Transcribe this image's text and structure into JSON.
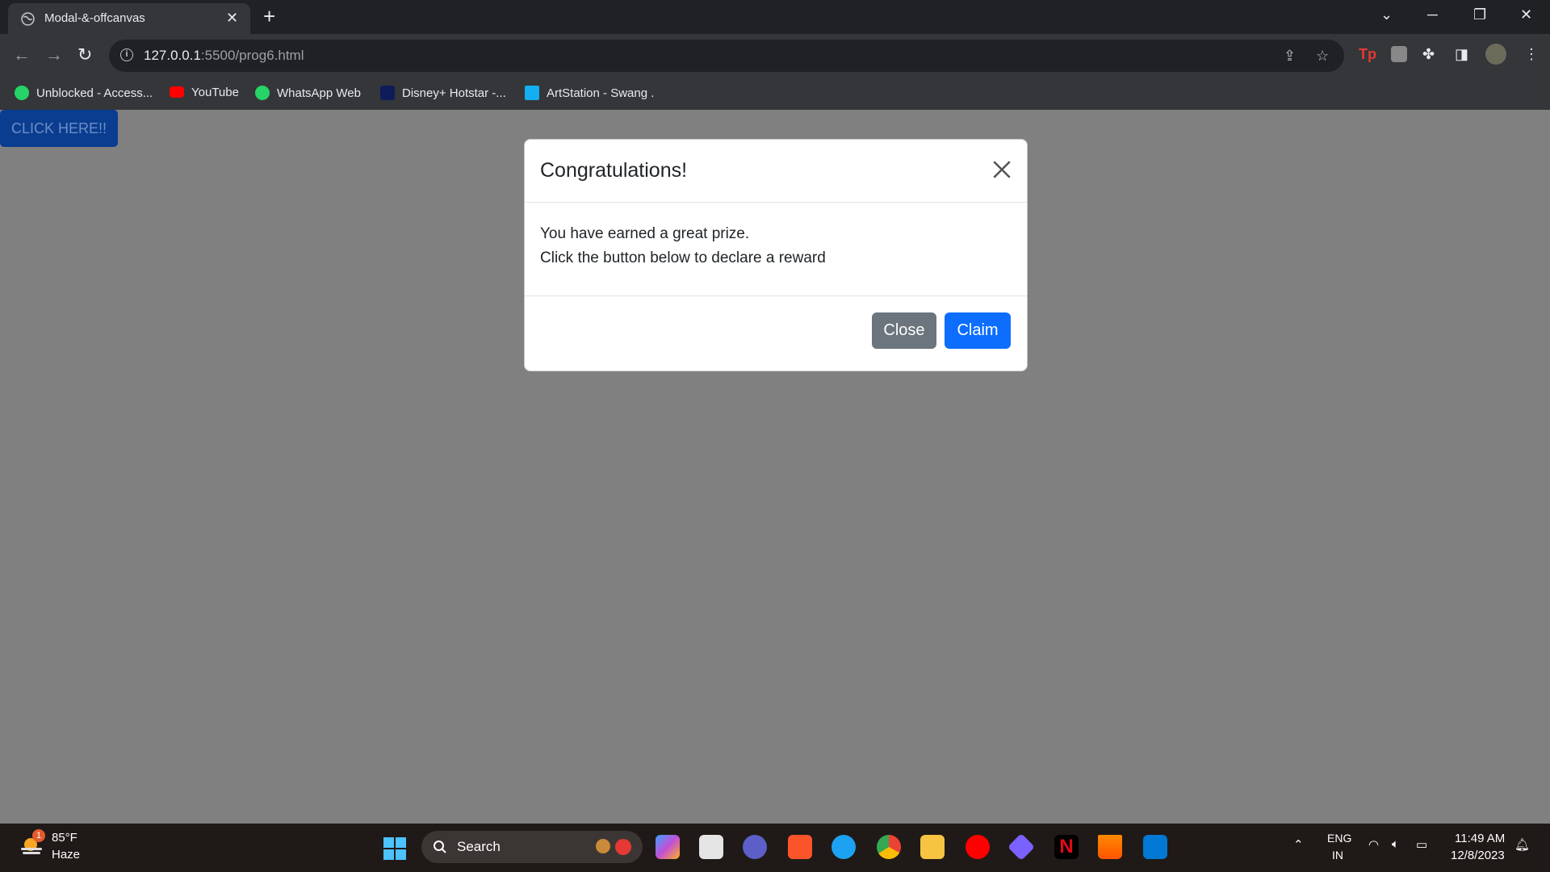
{
  "browser": {
    "tab_title": "Modal-&-offcanvas",
    "url_host": "127.0.0.1",
    "url_path": ":5500/prog6.html"
  },
  "bookmarks": [
    {
      "label": "Unblocked - Access...",
      "icon": "unblocked-icon",
      "color": "#25d366"
    },
    {
      "label": "YouTube",
      "icon": "youtube-icon",
      "color": "#ff0000"
    },
    {
      "label": "WhatsApp Web",
      "icon": "whatsapp-icon",
      "color": "#25d366"
    },
    {
      "label": "Disney+ Hotstar -...",
      "icon": "hotstar-icon",
      "color": "#0f1c5a"
    },
    {
      "label": "ArtStation - Swang .",
      "icon": "artstation-icon",
      "color": "#13aff0"
    }
  ],
  "page": {
    "trigger_label": "CLICK HERE!!"
  },
  "modal": {
    "title": "Congratulations!",
    "body_line1": "You have earned a great prize.",
    "body_line2": "Click the button below to declare a reward",
    "close_label": "Close",
    "claim_label": "Claim"
  },
  "taskbar": {
    "weather_temp": "85°F",
    "weather_desc": "Haze",
    "weather_badge": "1",
    "search_placeholder": "Search",
    "lang": "ENG",
    "region": "IN",
    "time": "11:49 AM",
    "date": "12/8/2023"
  },
  "colors": {
    "primary": "#0d6efd",
    "secondary": "#6c757d",
    "backdrop": "#808080"
  }
}
